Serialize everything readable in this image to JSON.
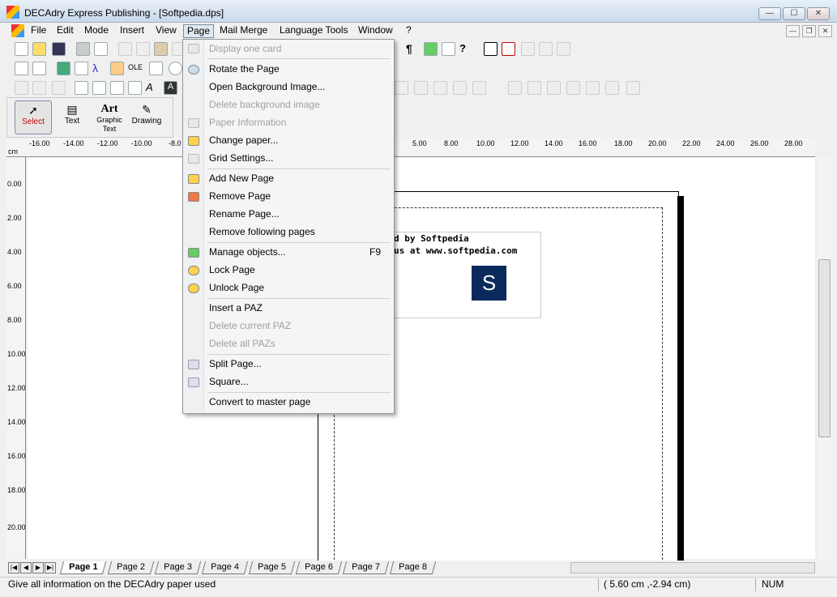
{
  "window": {
    "title": "DECAdry Express Publishing - [Softpedia.dps]",
    "minimize": "—",
    "maximize": "☐",
    "close": "✕"
  },
  "menubar": {
    "items": [
      "File",
      "Edit",
      "Mode",
      "Insert",
      "View",
      "Page",
      "Mail Merge",
      "Language Tools",
      "Window",
      "?"
    ]
  },
  "tools": {
    "select": "Select",
    "text": "Text",
    "graphic_text": "Graphic Text",
    "art": "Art",
    "drawing": "Drawing"
  },
  "ruler": {
    "unit": "cm",
    "h_ticks": [
      "-16.00",
      "-14.00",
      "-12.00",
      "-10.00",
      "-8.0",
      "8.00",
      "10.00",
      "12.00",
      "14.00",
      "16.00",
      "18.00",
      "20.00",
      "22.00",
      "24.00",
      "26.00",
      "28.00"
    ],
    "h_tick_partial": "5.00",
    "v_ticks": [
      "0.00",
      "2.00",
      "4.00",
      "6.00",
      "8.00",
      "10.00",
      "12.00",
      "14.00",
      "16.00",
      "18.00",
      "20.00"
    ]
  },
  "document": {
    "line1": "d by Softpedia",
    "line2": "us at www.softpedia.com",
    "logo_letter": "S"
  },
  "page_menu": {
    "display_one_card": "Display one card",
    "rotate": "Rotate the Page",
    "open_bg": "Open Background Image...",
    "delete_bg": "Delete background image",
    "paper_info": "Paper Information",
    "change_paper": "Change paper...",
    "grid_settings": "Grid Settings...",
    "add_page": "Add New Page",
    "remove_page": "Remove Page",
    "rename_page": "Rename Page...",
    "remove_following": "Remove following pages",
    "manage_objects": "Manage objects...",
    "manage_shortcut": "F9",
    "lock_page": "Lock Page",
    "unlock_page": "Unlock Page",
    "insert_paz": "Insert a PAZ",
    "delete_current_paz": "Delete current PAZ",
    "delete_all_paz": "Delete all PAZs",
    "split_page": "Split Page...",
    "square": "Square...",
    "convert_master": "Convert to master page"
  },
  "page_tabs": [
    "Page 1",
    "Page 2",
    "Page 3",
    "Page 4",
    "Page 5",
    "Page 6",
    "Page 7",
    "Page 8"
  ],
  "statusbar": {
    "message": "Give all information on the DECAdry paper used",
    "coords": "( 5.60 cm ,-2.94 cm)",
    "num": "NUM"
  }
}
